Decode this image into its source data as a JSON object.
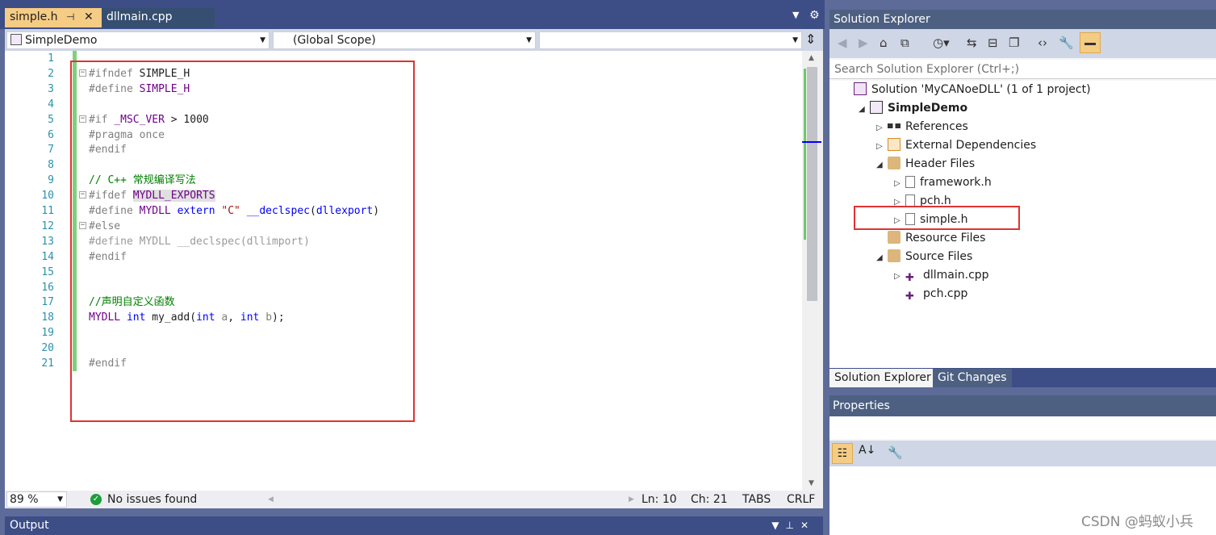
{
  "editor_tabs": {
    "active": "simple.h",
    "other": "dllmain.cpp",
    "pin_glyph": "⊣",
    "close_glyph": "✕"
  },
  "navigation": {
    "project": "SimpleDemo",
    "scope": "(Global Scope)",
    "member": ""
  },
  "code_lines": [
    {
      "n": "1",
      "html": ""
    },
    {
      "n": "2",
      "html": "<span class=\"gray\">#ifndef</span> SIMPLE_H"
    },
    {
      "n": "3",
      "html": "<span class=\"gray\">#define</span> <span class=\"mac\">SIMPLE_H</span>"
    },
    {
      "n": "4",
      "html": ""
    },
    {
      "n": "5",
      "html": "<span class=\"gray\">#if</span> <span class=\"mac\">_MSC_VER</span> &gt; 1000"
    },
    {
      "n": "6",
      "html": "<span class=\"gray\">#pragma once</span>"
    },
    {
      "n": "7",
      "html": "<span class=\"gray\">#endif</span>"
    },
    {
      "n": "8",
      "html": ""
    },
    {
      "n": "9",
      "html": "<span class=\"cm\">// C++ 常规编译写法</span>"
    },
    {
      "n": "10",
      "html": "<span class=\"gray\">#ifdef</span> <span class=\"hl\">MYDLL_EXPORTS</span>"
    },
    {
      "n": "11",
      "html": "<span class=\"gray\">#define</span> <span class=\"mac\">MYDLL</span> <span class=\"kw\">extern</span> <span class=\"str\">\"C\"</span> <span class=\"kw\">__declspec</span>(<span class=\"kw\">dllexport</span>)"
    },
    {
      "n": "12",
      "html": "<span class=\"gray\">#else</span>"
    },
    {
      "n": "13",
      "html": "<span class=\"dim\">#define MYDLL __declspec(dllimport)</span>"
    },
    {
      "n": "14",
      "html": "<span class=\"gray\">#endif</span>"
    },
    {
      "n": "15",
      "html": ""
    },
    {
      "n": "16",
      "html": ""
    },
    {
      "n": "17",
      "html": "<span class=\"cm\">//声明自定义函数</span>"
    },
    {
      "n": "18",
      "html": "<span class=\"mac\">MYDLL</span> <span class=\"kw\">int</span> my_add(<span class=\"kw\">int</span> <span class=\"gray\">a</span>, <span class=\"kw\">int</span> <span class=\"gray\">b</span>);"
    },
    {
      "n": "19",
      "html": ""
    },
    {
      "n": "20",
      "html": ""
    },
    {
      "n": "21",
      "html": "<span class=\"gray\">#endif</span>"
    }
  ],
  "fold_marks": [
    "2",
    "5",
    "10",
    "12"
  ],
  "status": {
    "zoom": "89 %",
    "issues": "No issues found",
    "ln": "Ln: 10",
    "ch": "Ch: 21",
    "indent": "TABS",
    "eol": "CRLF"
  },
  "output": {
    "title": "Output"
  },
  "solution_explorer": {
    "title": "Solution Explorer",
    "search_placeholder": "Search Solution Explorer (Ctrl+;)",
    "tree": [
      {
        "label": "Solution 'MyCANoeDLL' (1 of 1 project)",
        "icon": "solution-icon",
        "indent": 0,
        "twisty": "",
        "bold": false
      },
      {
        "label": "SimpleDemo",
        "icon": "project-icon",
        "indent": 1,
        "twisty": "◢",
        "bold": true
      },
      {
        "label": "References",
        "icon": "references-icon",
        "indent": 2,
        "twisty": "▷",
        "bold": false
      },
      {
        "label": "External Dependencies",
        "icon": "external-deps-icon",
        "indent": 2,
        "twisty": "▷",
        "bold": false
      },
      {
        "label": "Header Files",
        "icon": "filter-folder-icon",
        "indent": 2,
        "twisty": "◢",
        "bold": false
      },
      {
        "label": "framework.h",
        "icon": "header-file-icon",
        "indent": 3,
        "twisty": "▷",
        "bold": false
      },
      {
        "label": "pch.h",
        "icon": "header-file-icon",
        "indent": 3,
        "twisty": "▷",
        "bold": false
      },
      {
        "label": "simple.h",
        "icon": "header-file-icon",
        "indent": 3,
        "twisty": "▷",
        "bold": false
      },
      {
        "label": "Resource Files",
        "icon": "filter-folder-icon",
        "indent": 2,
        "twisty": "",
        "bold": false
      },
      {
        "label": "Source Files",
        "icon": "filter-folder-icon",
        "indent": 2,
        "twisty": "◢",
        "bold": false
      },
      {
        "label": "dllmain.cpp",
        "icon": "cpp-file-icon",
        "indent": 3,
        "twisty": "▷",
        "bold": false
      },
      {
        "label": "pch.cpp",
        "icon": "cpp-file-icon",
        "indent": 3,
        "twisty": "",
        "bold": false
      }
    ],
    "tabs": [
      "Solution Explorer",
      "Git Changes"
    ]
  },
  "properties": {
    "title": "Properties"
  },
  "watermark": "CSDN @蚂蚁小兵",
  "colors": {
    "accent_tab": "#f5cc84",
    "chrome": "#3d4d86",
    "annotation_red": "#e03232"
  }
}
